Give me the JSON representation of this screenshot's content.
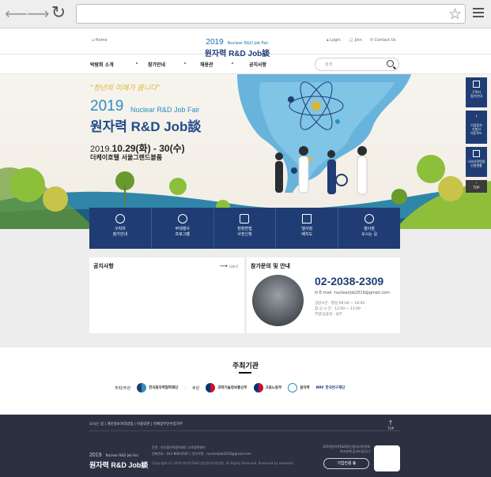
{
  "utility": {
    "home": "Home",
    "login": "Login",
    "join": "Join",
    "contact": "Contact Us"
  },
  "logo": {
    "year": "2019",
    "event_en": "Nuclear R&D Job Fair",
    "event_kr": "원자력 R&D Job談"
  },
  "nav": {
    "items": [
      "박람회 소개",
      "참가안내",
      "채용관",
      "공지사항"
    ],
    "search_placeholder": "검색"
  },
  "hero": {
    "slogan": "\"청년의 미래가 옵니다\"",
    "year": "2019",
    "event_en": "Nuclear R&D Job Fair",
    "event_kr": "원자력 R&D Job談",
    "date_prefix": "2019.",
    "date_main": "10.29(화) - 30(수)",
    "venue": "더케이호텔 서울그랜드볼룸"
  },
  "quick": [
    {
      "label1": "구직자",
      "label2": "참가안내"
    },
    {
      "label1": "부대행사",
      "label2": "프로그램"
    },
    {
      "label1": "현장면접",
      "label2": "사전신청"
    },
    {
      "label1": "행사장",
      "label2": "배치도"
    },
    {
      "label1": "행사장",
      "label2": "오시는 길"
    }
  ],
  "notice": {
    "title": "공지사항",
    "more": "더보기"
  },
  "contact": {
    "title": "참가문의 및 안내",
    "phone": "02-2038-2309",
    "email": "E-mail :nuclearjob2019@gmail.com",
    "hours1": "상담시간 : 평일 09:00 ~ 18:00",
    "hours2": "점 심 시 간 : 12:00 ~ 13:00",
    "hours3": "주말/공휴일 : 휴무"
  },
  "side": [
    {
      "l1": "구직자",
      "l2": "참가안내"
    },
    {
      "l1": "기업참가",
      "l2": "신청서",
      "l3": "다운로드"
    },
    {
      "l1": "나의사전면접",
      "l2": "신청현황"
    }
  ],
  "side_top": "TOP",
  "organizers": {
    "title": "주최기관",
    "host_label": "주최/주관",
    "org1": "한국원자력협력재단",
    "sponsor_label": "후원",
    "org2": "과학기술정보통신부",
    "org3": "고용노동부",
    "org4": "원자력",
    "org5": "NRF 한국연구재단"
  },
  "footer": {
    "links": "오시는 길  |  개인정보처리방침  |  이용약관  |  이메일무단수집거부",
    "top": "TOP",
    "year": "2019",
    "event_en": "Nuclear R&D Job Fair",
    "event_kr": "원자력 R&D Job談",
    "info1": "운영 : 한국원자력협력재단 교육협력센터",
    "info2": "전화번호 : 042-868-0587   |   전자우편 : nuclearjob2019@gmail.com",
    "copyright": "Copyright (c) 2019 원자력 R&D 청년일자리박람회. All Rights Reserved. Produced by webresto",
    "right1": "2019원자력R&D청년일자리박람회",
    "right2": "여러분께 감사드립니다",
    "company_btn": "기업전용"
  },
  "colors": {
    "navy": "#1f3d74",
    "blue": "#2a8fc2",
    "footer": "#2d3040"
  }
}
